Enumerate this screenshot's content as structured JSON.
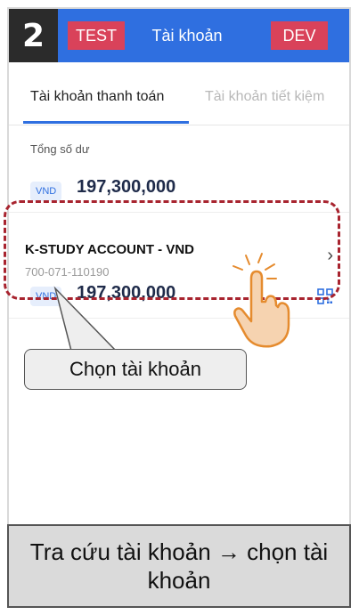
{
  "step": "2",
  "top_bar": {
    "test_tag": "TEST",
    "title": "Tài khoản",
    "dev_tag": "DEV"
  },
  "tabs": [
    {
      "label": "Tài khoản thanh toán",
      "active": true
    },
    {
      "label": "Tài khoản tiết kiệm",
      "active": false
    }
  ],
  "summary": {
    "label": "Tổng số dư",
    "currency": "VND",
    "amount": "197,300,000"
  },
  "account": {
    "name": "K-STUDY ACCOUNT - VND",
    "number": "700-071-110190",
    "currency": "VND",
    "amount": "197,300,000"
  },
  "callout": {
    "text": "Chọn tài khoản"
  },
  "footer": {
    "text": "Tra cứu tài khoản → chọn tài khoản"
  },
  "colors": {
    "primary": "#2f6fe0",
    "tag": "#d9425a",
    "highlight": "#a8242f",
    "hand": "#f0b173"
  },
  "icons": {
    "chevron": "chevron-right-icon",
    "qr": "qr-code-icon",
    "hand": "tap-hand-icon"
  }
}
